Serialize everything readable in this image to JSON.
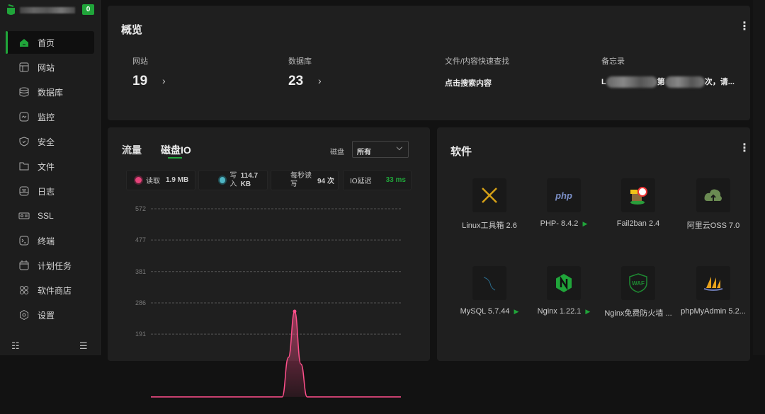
{
  "sidebar": {
    "badge": "0",
    "items": [
      {
        "label": "首页",
        "icon": "home-icon"
      },
      {
        "label": "网站",
        "icon": "website-icon"
      },
      {
        "label": "数据库",
        "icon": "database-icon"
      },
      {
        "label": "监控",
        "icon": "monitor-icon"
      },
      {
        "label": "安全",
        "icon": "shield-icon"
      },
      {
        "label": "文件",
        "icon": "folder-icon"
      },
      {
        "label": "日志",
        "icon": "log-icon"
      },
      {
        "label": "SSL",
        "icon": "certificate-icon"
      },
      {
        "label": "终端",
        "icon": "terminal-icon"
      },
      {
        "label": "计划任务",
        "icon": "calendar-icon"
      },
      {
        "label": "软件商店",
        "icon": "apps-icon"
      },
      {
        "label": "设置",
        "icon": "settings-icon"
      }
    ],
    "collapse_icon": "☷",
    "menu_icon": "☰"
  },
  "overview": {
    "title": "概览",
    "sites_label": "网站",
    "sites": "19",
    "db_label": "数据库",
    "db": "23",
    "search_label": "文件/内容快速查找",
    "search_text": "点击搜索内容",
    "memo_label": "备忘录",
    "memo_prefix": "L",
    "memo_mid": "第",
    "memo_suffix": "次，请..."
  },
  "traffic": {
    "tab_flow": "流量",
    "tab_disk": "磁盘IO",
    "disk_label": "磁盘",
    "disk_value": "所有",
    "read_label": "读取",
    "read_value": "1.9 MB",
    "write_label": "写入",
    "write_value": "114.7 KB",
    "iops_label": "每秒读写",
    "iops_value": "94 次",
    "latency_label": "IO延迟",
    "latency_value": "33 ms",
    "colors": {
      "read": "#e5437a",
      "write": "#4fb6c4",
      "latency": "#20a53a"
    }
  },
  "chart_data": {
    "type": "area",
    "title": "磁盘IO",
    "yticks": [
      191,
      286,
      381,
      477,
      572
    ],
    "ylim": [
      0,
      572
    ],
    "series": [
      {
        "name": "读取",
        "color": "#ff4f8b",
        "values": [
          0,
          0,
          0,
          0,
          0,
          0,
          0,
          0,
          0,
          0,
          0,
          0,
          0,
          0,
          0,
          0,
          0,
          0,
          0,
          0,
          0,
          0,
          120,
          260,
          100,
          0,
          0,
          0,
          0,
          0,
          0,
          0,
          0,
          0,
          0,
          0,
          0,
          0,
          0,
          0,
          0
        ]
      }
    ]
  },
  "software": {
    "title": "软件",
    "items": [
      {
        "name": "Linux工具箱 2.6",
        "running": false
      },
      {
        "name": "PHP- 8.4.2",
        "running": true
      },
      {
        "name": "Fail2ban 2.4",
        "running": false
      },
      {
        "name": "阿里云OSS 7.0",
        "running": false
      },
      {
        "name": "MySQL 5.7.44",
        "running": true
      },
      {
        "name": "Nginx 1.22.1",
        "running": true
      },
      {
        "name": "Nginx免费防火墙 ...",
        "running": false
      },
      {
        "name": "phpMyAdmin 5.2...",
        "running": false
      }
    ],
    "php_logo": "php",
    "waf_logo": "WAF",
    "play_icon": "▶"
  }
}
